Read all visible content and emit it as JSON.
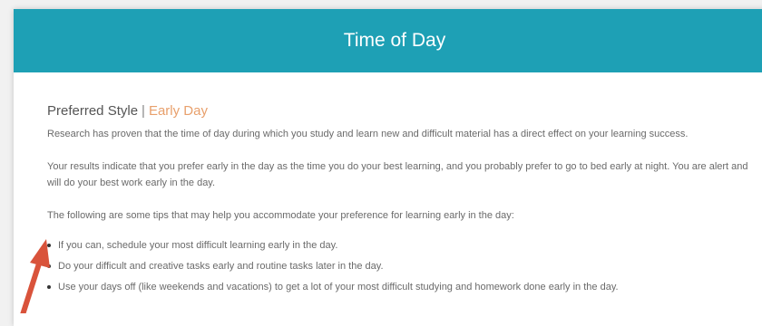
{
  "header": {
    "title": "Time of Day"
  },
  "section": {
    "label": "Preferred Style",
    "separator": "|",
    "value": "Early Day"
  },
  "paragraphs": [
    "Research has proven that the time of day during which you study and learn new and difficult material has a direct effect on your learning success.",
    "Your results indicate that you prefer early in the day as the time you do your best learning, and you probably prefer to go to bed early at night. You are alert and will do your best work early in the day.",
    "The following are some tips that may help you accommodate your preference for learning early in the day:"
  ],
  "tips": [
    "If you can, schedule your most difficult learning early in the day.",
    "Do your difficult and creative tasks early and routine tasks later in the day.",
    "Use your days off (like weekends and vacations) to get a lot of your most difficult studying and homework done early in the day."
  ],
  "colors": {
    "header_bg": "#1ea0b5",
    "accent": "#e8a06c",
    "annotation_arrow": "#d9533b"
  }
}
